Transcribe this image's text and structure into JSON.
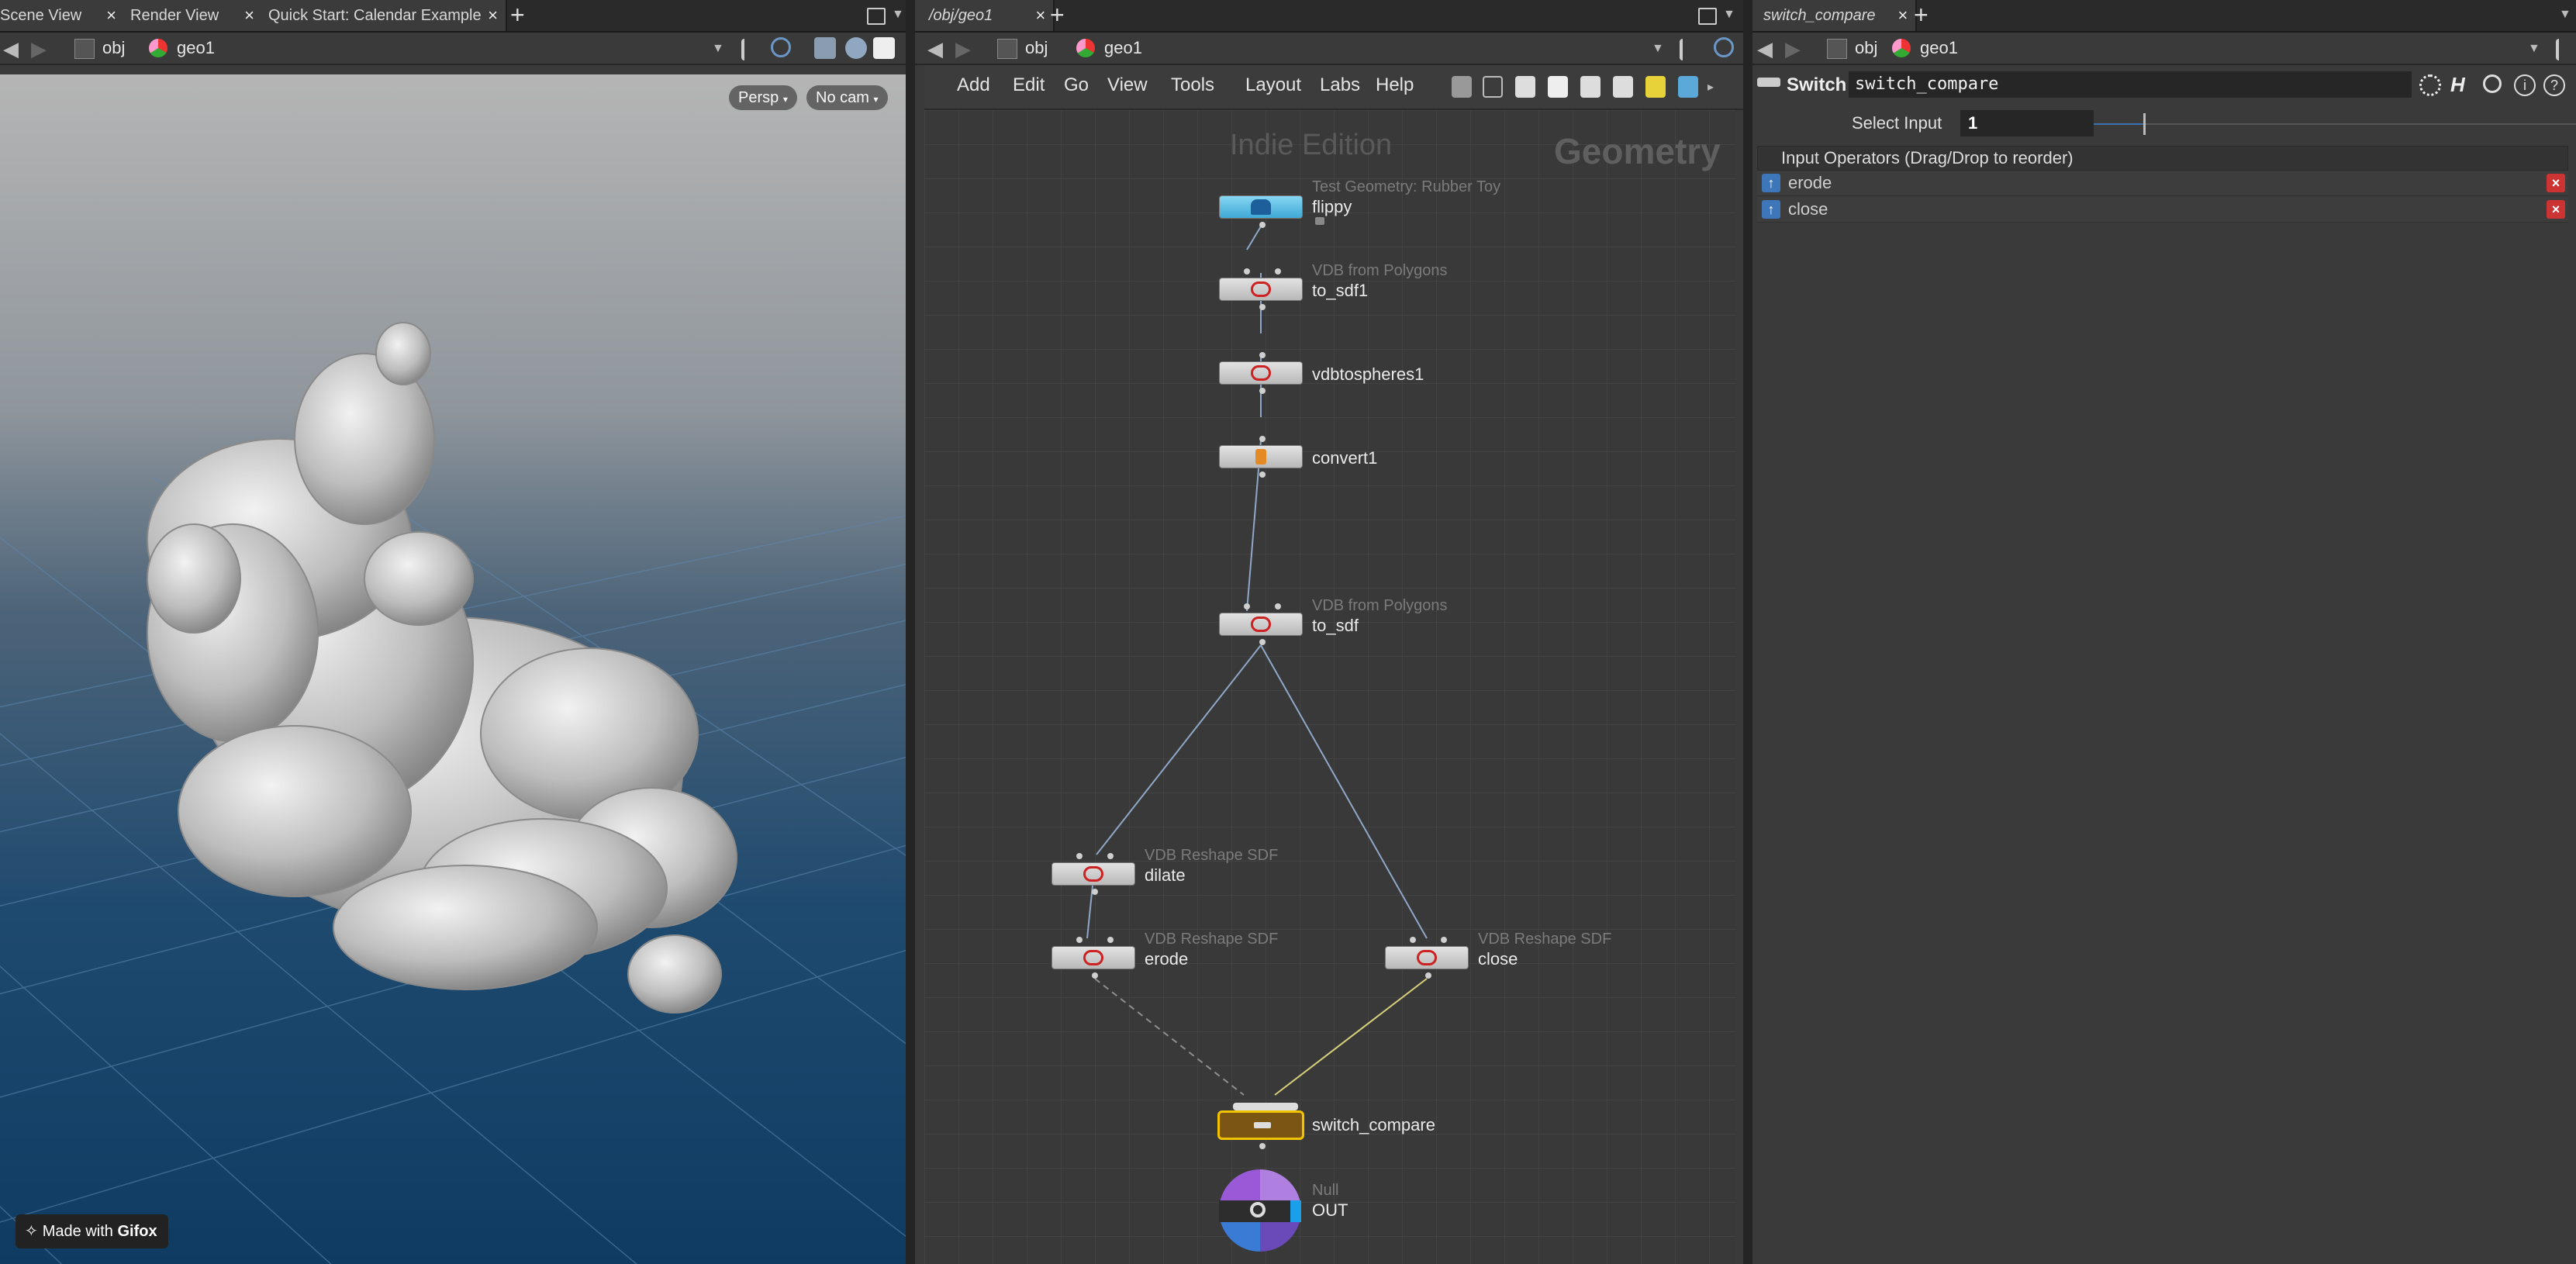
{
  "left_pane": {
    "tabs": [
      "Scene View",
      "Render View",
      "Quick Start: Calendar Example"
    ],
    "path": {
      "item1": "obj",
      "item2": "geo1"
    },
    "viewport": {
      "persp_label": "Persp",
      "camera_label": "No cam"
    },
    "watermark": {
      "prefix": "Made with",
      "brand": "Gifox"
    }
  },
  "mid_pane": {
    "tab": "/obj/geo1",
    "path": {
      "item1": "obj",
      "item2": "geo1"
    },
    "menu": [
      "Add",
      "Edit",
      "Go",
      "View",
      "Tools",
      "Layout",
      "Labs",
      "Help"
    ],
    "edition_watermark": "Indie Edition",
    "context_watermark": "Geometry",
    "nodes": {
      "flippy": {
        "type": "Test Geometry: Rubber Toy",
        "name": "flippy"
      },
      "to_sdf1": {
        "type": "VDB from Polygons",
        "name": "to_sdf1"
      },
      "vdbtospheres1": {
        "name": "vdbtospheres1"
      },
      "convert1": {
        "name": "convert1"
      },
      "to_sdf": {
        "type": "VDB from Polygons",
        "name": "to_sdf"
      },
      "dilate": {
        "type": "VDB Reshape SDF",
        "name": "dilate"
      },
      "erode": {
        "type": "VDB Reshape SDF",
        "name": "erode"
      },
      "close": {
        "type": "VDB Reshape SDF",
        "name": "close"
      },
      "switch_compare": {
        "name": "switch_compare"
      },
      "out": {
        "type": "Null",
        "name": "OUT"
      }
    }
  },
  "right_pane": {
    "tab": "switch_compare",
    "path": {
      "item1": "obj",
      "item2": "geo1"
    },
    "node_type": "Switch",
    "node_name": "switch_compare",
    "select_input_label": "Select Input",
    "select_input_value": "1",
    "input_ops_header": "Input Operators (Drag/Drop to reorder)",
    "input_ops": [
      "erode",
      "close"
    ]
  }
}
